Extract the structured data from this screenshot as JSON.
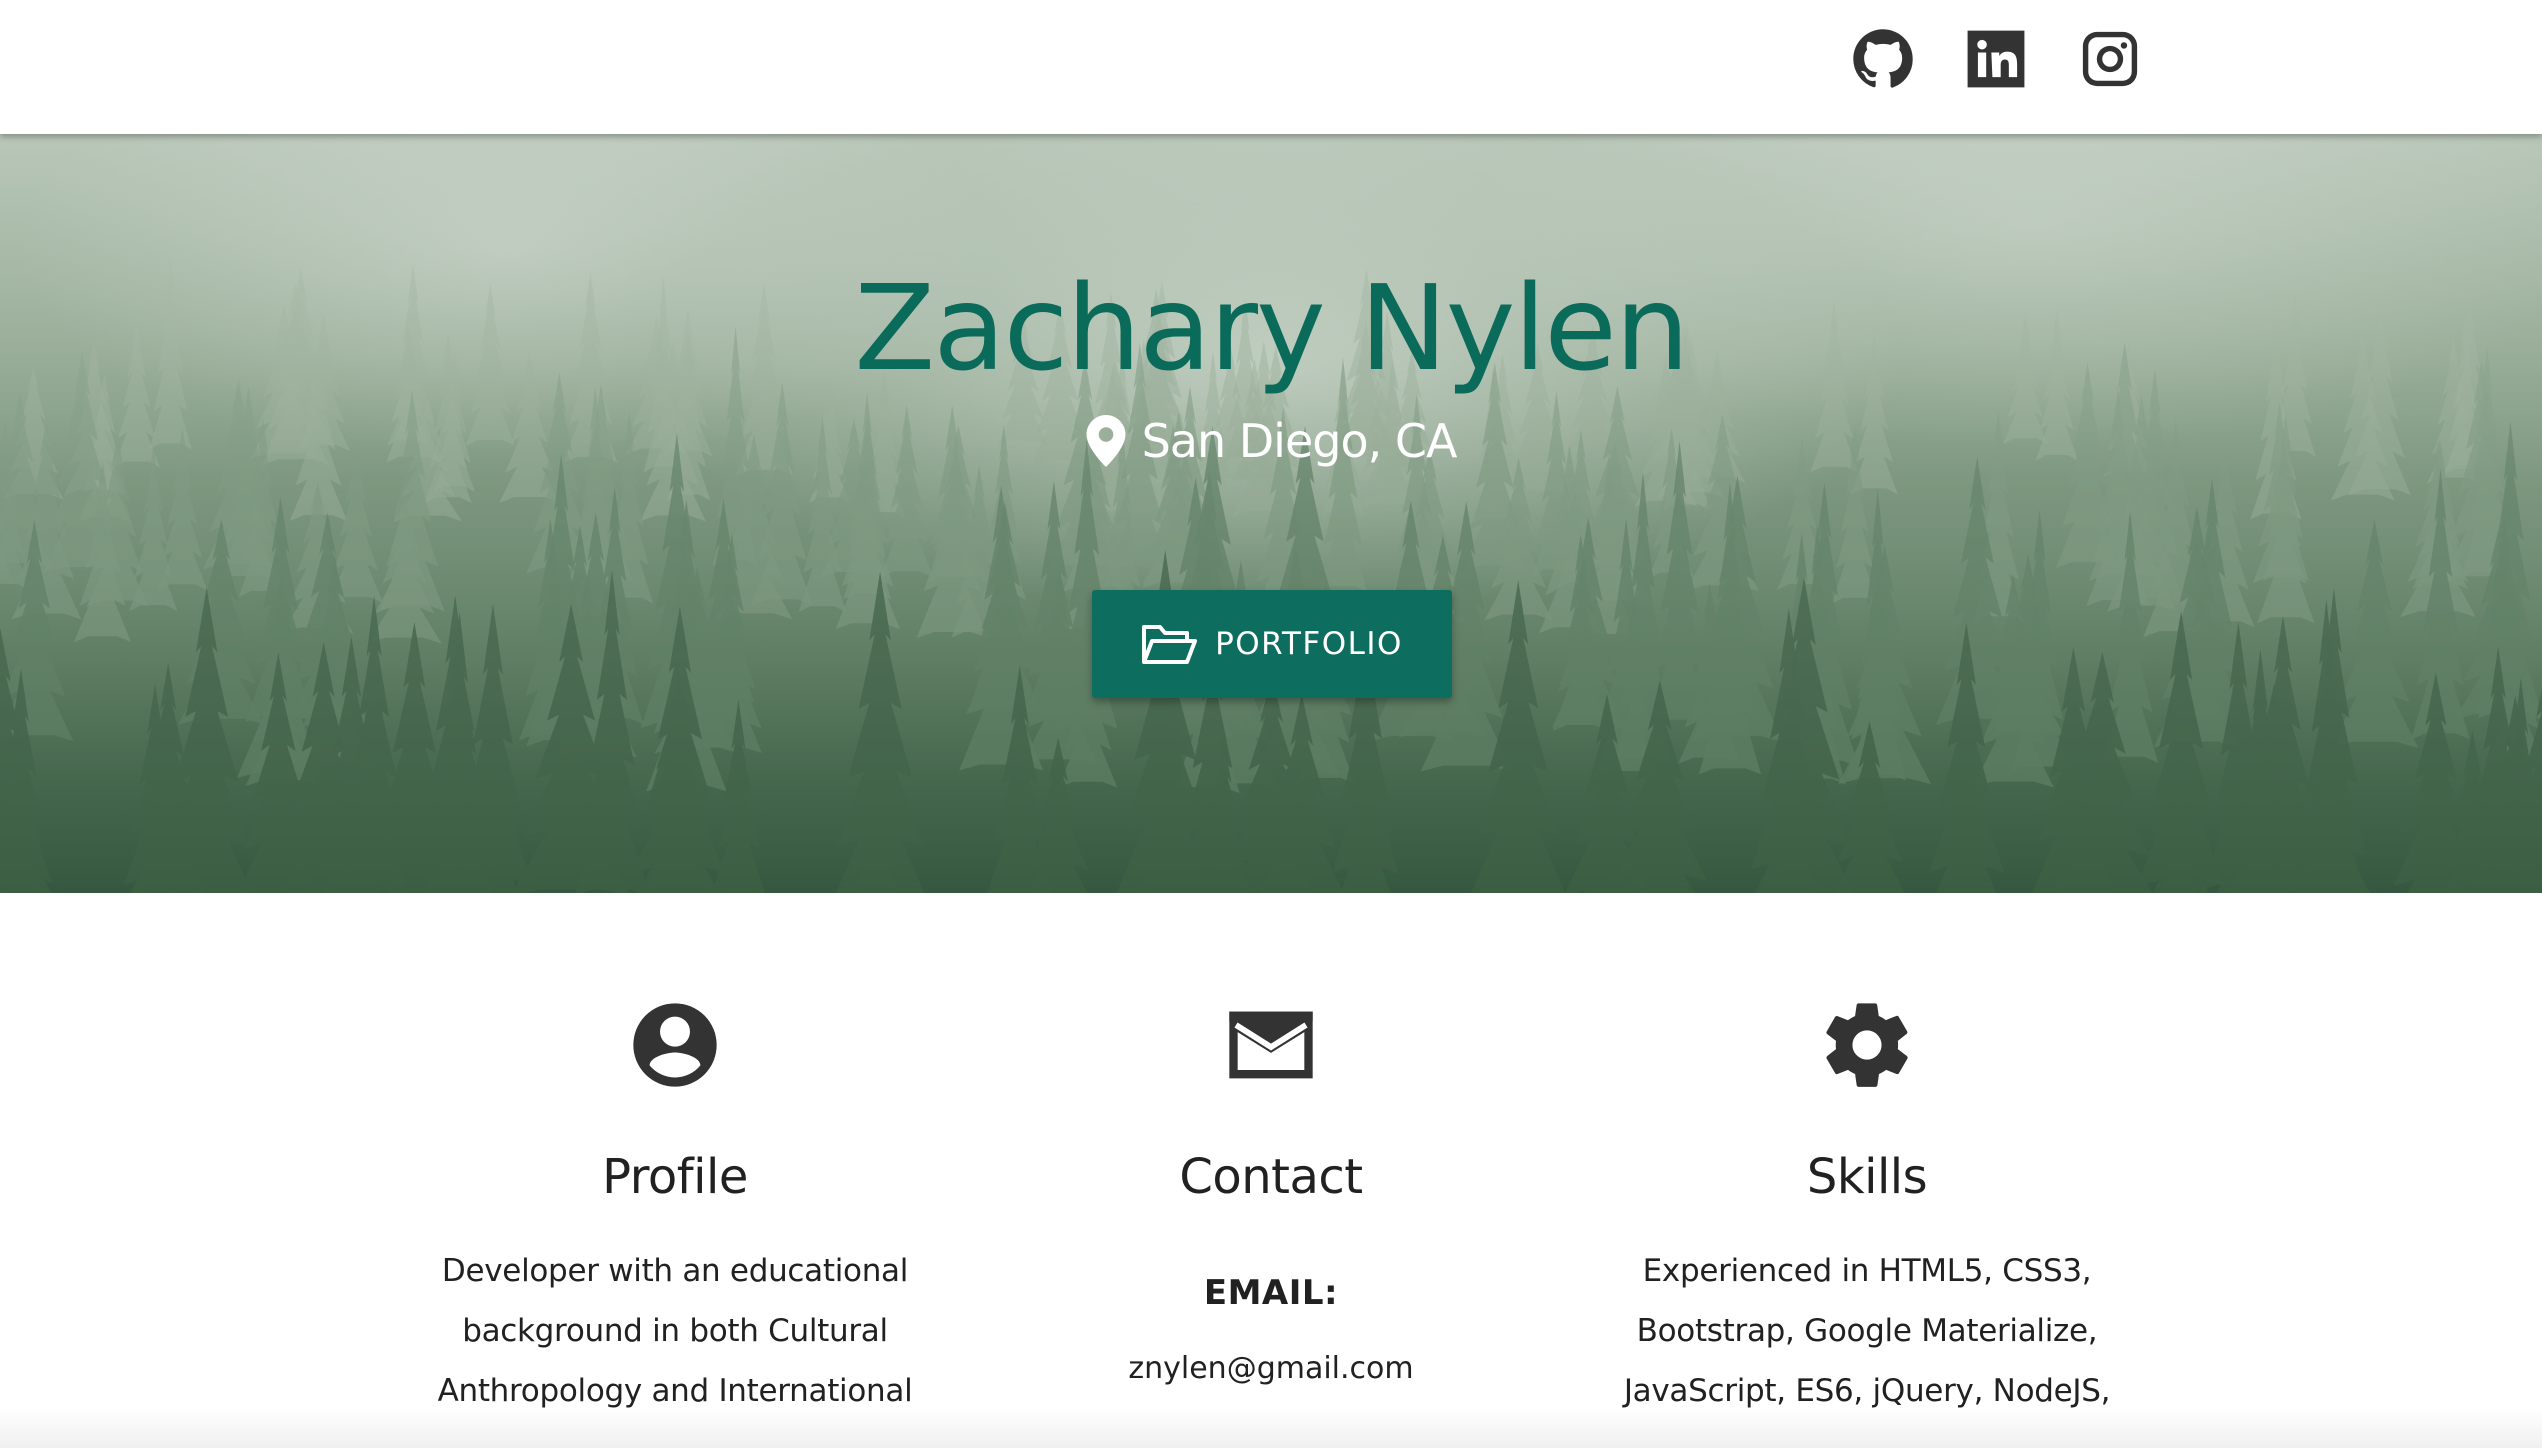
{
  "nav": {
    "social": [
      {
        "icon": "github-icon",
        "label": "GitHub"
      },
      {
        "icon": "linkedin-icon",
        "label": "LinkedIn"
      },
      {
        "icon": "instagram-icon",
        "label": "Instagram"
      }
    ]
  },
  "hero": {
    "name": "Zachary Nylen",
    "location": "San Diego, CA",
    "location_icon": "map-pin-icon",
    "button_label": "PORTFOLIO",
    "button_icon": "folder-open-icon"
  },
  "sections": {
    "profile": {
      "icon": "account-circle-icon",
      "title": "Profile",
      "text": "Developer with an educational background in both Cultural Anthropology and International"
    },
    "contact": {
      "icon": "mail-icon",
      "title": "Contact",
      "email_label": "EMAIL:",
      "email": "znylen@gmail.com"
    },
    "skills": {
      "icon": "gear-icon",
      "title": "Skills",
      "text": "Experienced in HTML5, CSS3, Bootstrap, Google Materialize, JavaScript, ES6, jQuery, NodeJS,"
    }
  },
  "colors": {
    "accent": "#0d6e5f",
    "title": "#0b6b5a",
    "icon": "#333333"
  }
}
